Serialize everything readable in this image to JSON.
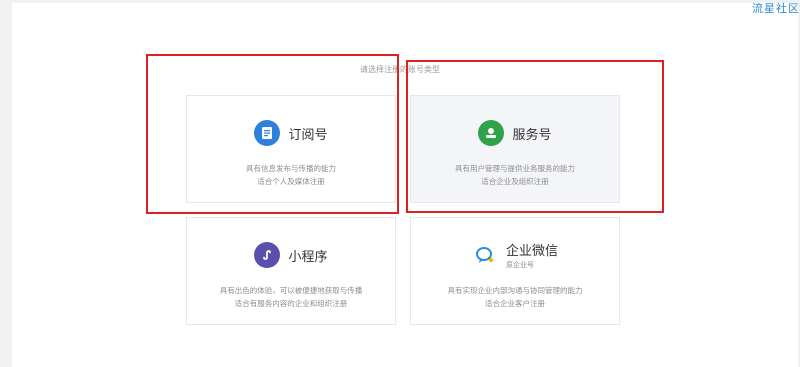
{
  "watermark": "流星社区",
  "prompt": "请选择注册的账号类型",
  "cards": [
    {
      "title": "订阅号",
      "icon": "document-icon",
      "color": "#2f7fdc",
      "desc1": "具有信息发布与传播的能力",
      "desc2": "适合个人及媒体注册"
    },
    {
      "title": "服务号",
      "icon": "user-icon",
      "color": "#2ea34b",
      "desc1": "具有用户管理与提供业务服务的能力",
      "desc2": "适合企业及组织注册"
    },
    {
      "title": "小程序",
      "icon": "mini-program-icon",
      "color": "#5b4fae",
      "desc1": "具有出色的体验，可以被便捷地获取与传播",
      "desc2": "适合有服务内容的企业和组织注册"
    },
    {
      "title": "企业微信",
      "subtitle": "原企业号",
      "icon": "chat-bubble-icon",
      "color": "#2e8ae6",
      "desc1": "具有实现企业内部沟通与协同管理的能力",
      "desc2": "适合企业客户注册"
    }
  ]
}
